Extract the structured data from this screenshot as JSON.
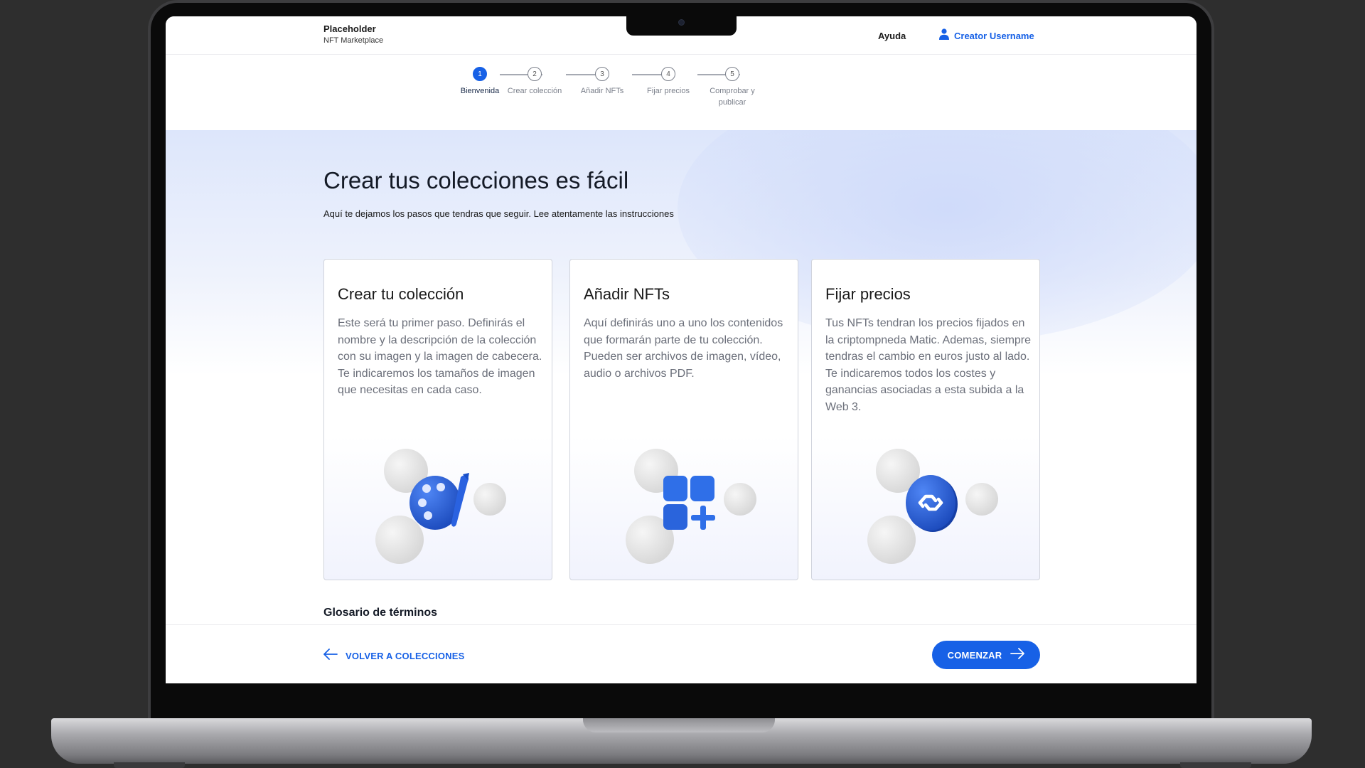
{
  "header": {
    "brand_title": "Placeholder",
    "brand_subtitle": "NFT Marketplace",
    "help_label": "Ayuda",
    "user_label": "Creator Username",
    "user_icon": "user-icon"
  },
  "stepper": {
    "active_step": 1,
    "steps": [
      {
        "number": "1",
        "label": "Bienvenida"
      },
      {
        "number": "2",
        "label": "Crear colección"
      },
      {
        "number": "3",
        "label": "Añadir NFTs"
      },
      {
        "number": "4",
        "label": "Fijar precios"
      },
      {
        "number": "5",
        "label": "Comprobar y publicar"
      }
    ]
  },
  "main": {
    "title": "Crear tus colecciones es fácil",
    "subtitle": "Aquí te dejamos los pasos que tendras que seguir. Lee atentamente las instrucciones",
    "cards": [
      {
        "title": "Crear tu colección",
        "text": "Este será tu primer paso. Definirás el nombre y la descripción de la colección con su imagen y la imagen de cabecera. Te indicaremos los tamaños de imagen que necesitas en cada caso.",
        "icon": "palette-icon"
      },
      {
        "title": "Añadir NFTs",
        "text": "Aquí definirás uno a uno los contenidos que formarán parte de tu colección. Pueden ser archivos de imagen, vídeo, audio o archivos PDF.",
        "icon": "add-grid-icon"
      },
      {
        "title": "Fijar precios",
        "text": "Tus NFTs tendran los precios fijados en la criptompneda Matic. Ademas, siempre tendras el cambio en euros justo al lado. Te indicaremos todos los costes y ganancias asociadas a esta subida a la  Web 3.",
        "icon": "polygon-matic-icon"
      }
    ],
    "glossary_title": "Glosario de términos"
  },
  "footer": {
    "back_label": "VOLVER A COLECCIONES",
    "start_label": "COMENZAR"
  },
  "colors": {
    "accent": "#1761e6",
    "background": "#2e2e2e",
    "text_dark": "#141a26",
    "text_muted": "#6b6f7a"
  }
}
